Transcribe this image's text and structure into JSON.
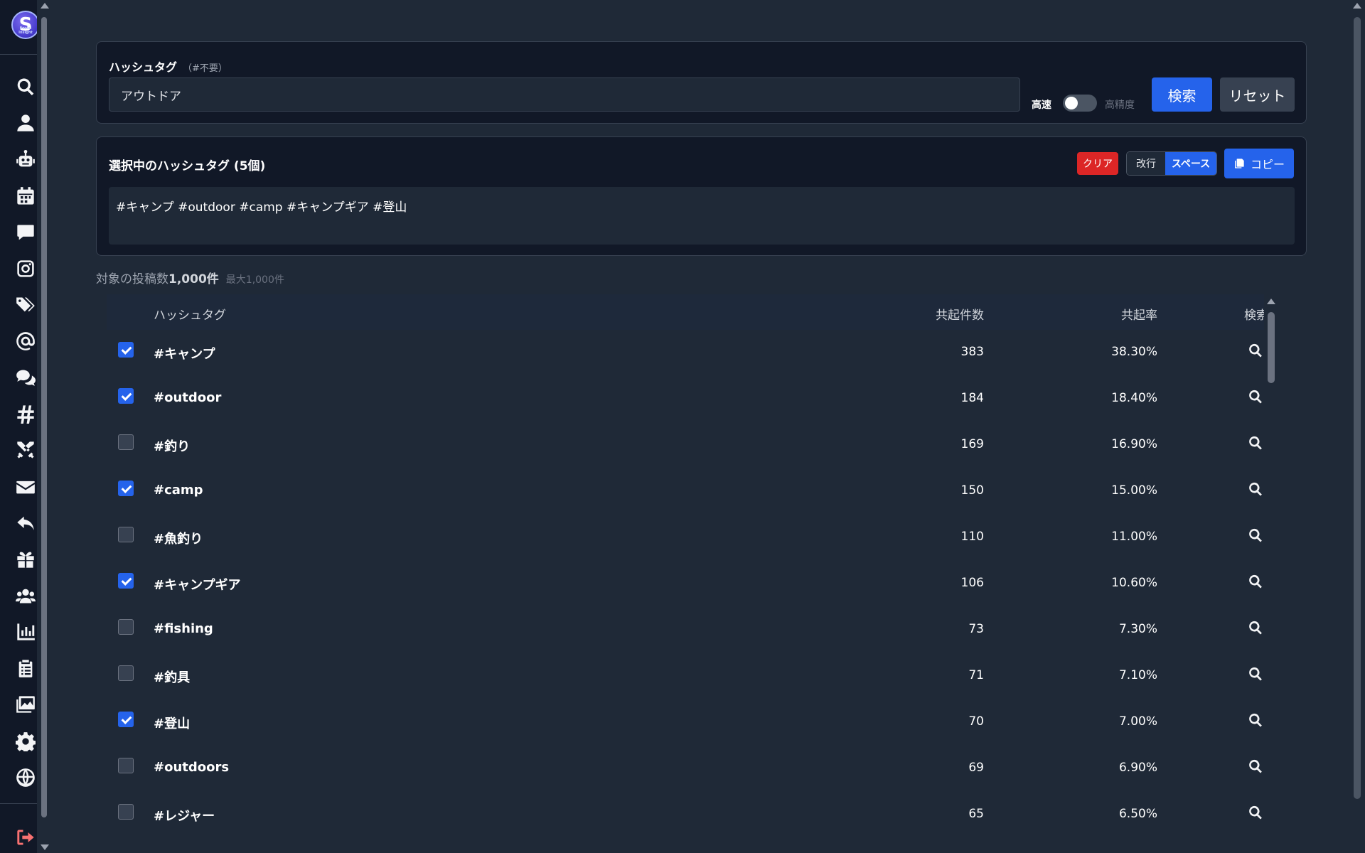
{
  "sidebar": {
    "logo_letter": "S",
    "logo_sub": "Social Insight",
    "items": [
      {
        "name": "search-icon"
      },
      {
        "name": "user-icon"
      },
      {
        "name": "robot-icon"
      },
      {
        "name": "calendar-icon"
      },
      {
        "name": "comment-icon"
      },
      {
        "name": "instagram-icon"
      },
      {
        "name": "tags-icon"
      },
      {
        "name": "at-icon"
      },
      {
        "name": "comments-icon"
      },
      {
        "name": "hashtag-icon"
      },
      {
        "name": "swords-icon"
      },
      {
        "name": "envelope-icon"
      },
      {
        "name": "reply-icon"
      },
      {
        "name": "gift-icon"
      },
      {
        "name": "users-icon"
      },
      {
        "name": "chart-icon"
      },
      {
        "name": "clipboard-icon"
      },
      {
        "name": "images-icon"
      },
      {
        "name": "gear-icon"
      },
      {
        "name": "globe-icon"
      },
      {
        "name": "logout-icon"
      }
    ]
  },
  "search": {
    "label": "ハッシュタグ",
    "note": "（#不要）",
    "value": "アウトドア",
    "mode_fast": "高速",
    "mode_precise": "高精度",
    "search_button": "検索",
    "reset_button": "リセット"
  },
  "selected": {
    "title": "選択中のハッシュタグ (5個)",
    "clear_button": "クリア",
    "sep_newline": "改行",
    "sep_space": "スペース",
    "copy_button": "コピー",
    "text": "#キャンプ #outdoor #camp #キャンプギア #登山"
  },
  "summary": {
    "prefix": "対象の投稿数",
    "count": "1,000件",
    "max": "最大1,000件"
  },
  "table": {
    "headers": {
      "hashtag": "ハッシュタグ",
      "count": "共起件数",
      "rate": "共起率",
      "search": "検索"
    },
    "rows": [
      {
        "tag": "#キャンプ",
        "count": "383",
        "rate": "38.30%",
        "checked": true
      },
      {
        "tag": "#outdoor",
        "count": "184",
        "rate": "18.40%",
        "checked": true
      },
      {
        "tag": "#釣り",
        "count": "169",
        "rate": "16.90%",
        "checked": false
      },
      {
        "tag": "#camp",
        "count": "150",
        "rate": "15.00%",
        "checked": true
      },
      {
        "tag": "#魚釣り",
        "count": "110",
        "rate": "11.00%",
        "checked": false
      },
      {
        "tag": "#キャンプギア",
        "count": "106",
        "rate": "10.60%",
        "checked": true
      },
      {
        "tag": "#fishing",
        "count": "73",
        "rate": "7.30%",
        "checked": false
      },
      {
        "tag": "#釣具",
        "count": "71",
        "rate": "7.10%",
        "checked": false
      },
      {
        "tag": "#登山",
        "count": "70",
        "rate": "7.00%",
        "checked": true
      },
      {
        "tag": "#outdoors",
        "count": "69",
        "rate": "6.90%",
        "checked": false
      },
      {
        "tag": "#レジャー",
        "count": "65",
        "rate": "6.50%",
        "checked": false
      }
    ]
  },
  "colors": {
    "accent": "#2563eb",
    "danger": "#dc2626",
    "background": "#1f2937",
    "card": "#111827"
  }
}
